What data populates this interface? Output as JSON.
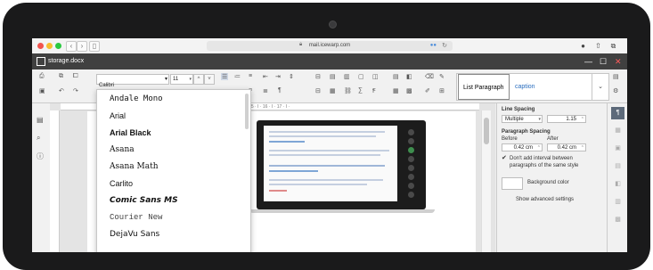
{
  "browser": {
    "url": "mail.icewarp.com",
    "url_extra": "●●",
    "reload_icon": "reload-icon",
    "back_icon": "chevron-left-icon",
    "forward_icon": "chevron-right-icon"
  },
  "app": {
    "doc_title": "storage.docx",
    "window_buttons": [
      "—",
      "☐",
      "✕"
    ]
  },
  "toolbar": {
    "font_name": "Calibri",
    "font_size": "11",
    "styles": [
      {
        "label": "List Paragraph",
        "selected": true
      },
      {
        "label": "caption",
        "selected": false
      }
    ]
  },
  "font_dropdown": {
    "items": [
      {
        "label": "Andale Mono"
      },
      {
        "label": "Arial"
      },
      {
        "label": "Arial Black"
      },
      {
        "label": "Asana"
      },
      {
        "label": "Asana Math"
      },
      {
        "label": "Carlito"
      },
      {
        "label": "Comic Sans MS"
      },
      {
        "label": "Courier New"
      },
      {
        "label": "DejaVu Sans"
      }
    ]
  },
  "right_panel": {
    "line_spacing_label": "Line Spacing",
    "line_spacing_mode": "Multiple",
    "line_spacing_value": "1.15",
    "paragraph_spacing_label": "Paragraph Spacing",
    "before_label": "Before",
    "after_label": "After",
    "before_value": "0.42 cm",
    "after_value": "0.42 cm",
    "dont_add_interval_line1": "Don't add interval between",
    "dont_add_interval_line2": "paragraphs of the same style",
    "dont_add_interval_checked": true,
    "background_color_label": "Background color",
    "show_advanced_label": "Show advanced settings"
  },
  "colors": {
    "titlebar": "#404040",
    "accent_blue": "#2a6ebf",
    "active_tab": "#5d6a7a"
  }
}
